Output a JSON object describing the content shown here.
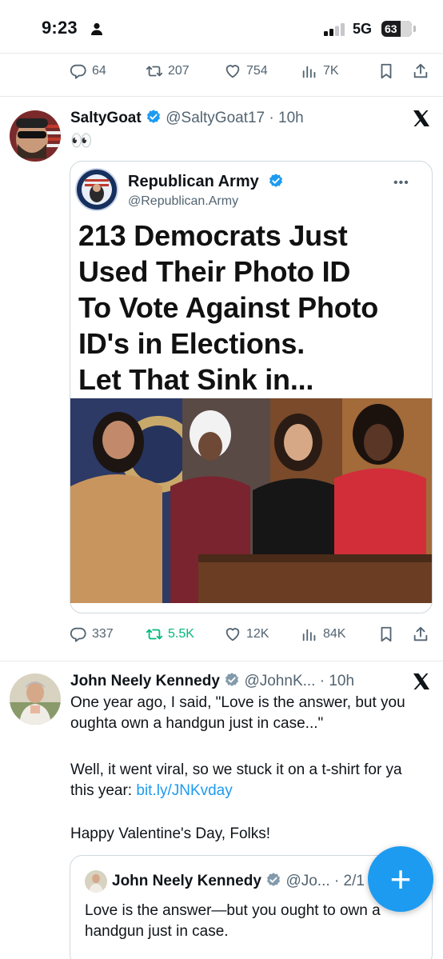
{
  "status_bar": {
    "time": "9:23",
    "network": "5G",
    "battery": "63"
  },
  "tweet0": {
    "replies": "64",
    "retweets": "207",
    "likes": "754",
    "views": "7K"
  },
  "tweet1": {
    "name": "SaltyGoat",
    "handle": "@SaltyGoat17 · 10h",
    "text": "👀",
    "embed": {
      "account_name": "Republican Army",
      "account_handle": "@Republican.Army",
      "more": "•••",
      "headline": "213 Democrats Just\nUsed Their Photo ID\nTo Vote Against Photo\nID's in Elections.\nLet That Sink in..."
    },
    "replies": "337",
    "retweets": "5.5K",
    "likes": "12K",
    "views": "84K"
  },
  "tweet2": {
    "name": "John Neely Kennedy",
    "handle": "@JohnK... · 10h",
    "text_para1": "One year ago, I said, \"Love is the answer, but you oughta own a handgun just in case...\"",
    "text_para2_prefix": "Well, it went viral, so we stuck it on a t-shirt for ya this year: ",
    "text_para2_link": "bit.ly/JNKvday",
    "text_para3": "Happy Valentine's Day, Folks!",
    "quote": {
      "name": "John Neely Kennedy",
      "handle": "@Jo... · 2/1",
      "text": "Love is the answer—but you ought to own a handgun just in case."
    }
  },
  "fab_label": "+",
  "colors": {
    "accent": "#1d9bf0",
    "muted": "#536471",
    "retweet_active": "#00ba7c"
  }
}
